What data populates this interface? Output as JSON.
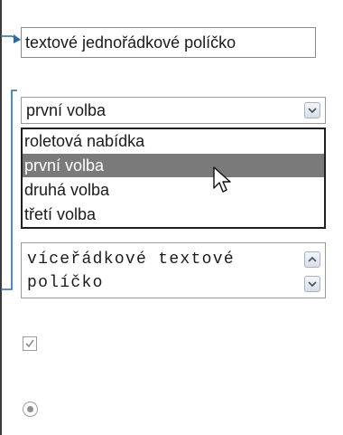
{
  "text_field": {
    "value": "textové jednořádkové políčko"
  },
  "select": {
    "value": "první volba",
    "arrow_icon": "chevron-down-icon"
  },
  "dropdown": {
    "options": [
      "roletová nabídka",
      "první volba",
      "druhá volba",
      "třetí volba"
    ],
    "selected_index": 1
  },
  "textarea": {
    "lines": [
      "víceřádkové textové",
      "políčko"
    ],
    "scroll_up_icon": "chevron-up-icon",
    "scroll_down_icon": "chevron-down-icon"
  },
  "checkbox": {
    "checked": true
  },
  "radio": {
    "selected": true
  },
  "colors": {
    "connector": "#1f6fb0",
    "selected_option_bg": "#7a7a7a"
  }
}
